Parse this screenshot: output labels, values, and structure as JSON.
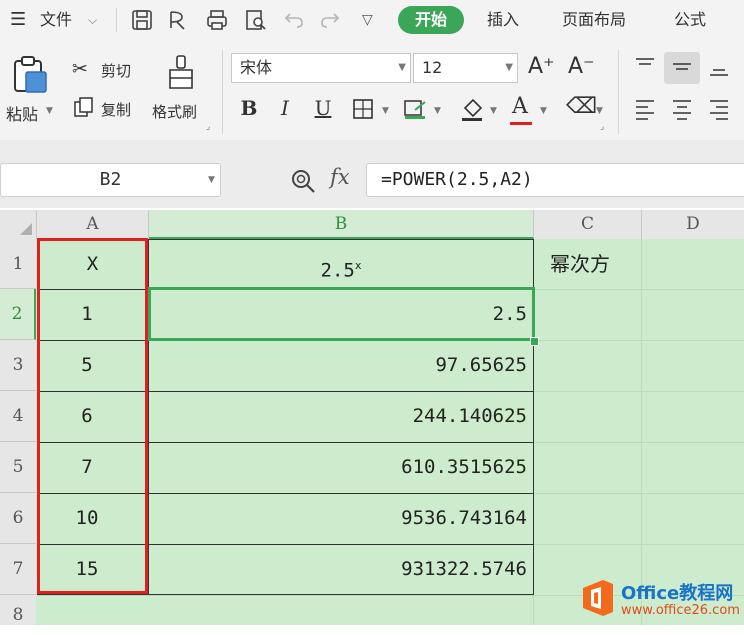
{
  "menubar": {
    "file_label": "文件",
    "tabs": [
      "开始",
      "插入",
      "页面布局",
      "公式"
    ]
  },
  "ribbon": {
    "paste": "粘贴",
    "cut": "剪切",
    "copy": "复制",
    "format_painter": "格式刷",
    "font_name": "宋体",
    "font_size": "12",
    "increase_font": "A⁺",
    "decrease_font": "A⁻",
    "bold": "B",
    "italic": "I",
    "underline": "U"
  },
  "formula_bar": {
    "cell_ref": "B2",
    "fx": "fx",
    "formula": "=POWER(2.5,A2)"
  },
  "sheet": {
    "columns": [
      "A",
      "B",
      "C",
      "D"
    ],
    "rows": [
      "1",
      "2",
      "3",
      "4",
      "5",
      "6",
      "7",
      "8"
    ],
    "a_values": [
      "X",
      "1",
      "5",
      "6",
      "7",
      "10",
      "15"
    ],
    "b_header_base": "2.5",
    "b_header_exp": "x",
    "b_values": [
      "2.5",
      "97.65625",
      "244.140625",
      "610.3515625",
      "9536.743164",
      "931322.5746"
    ],
    "c1": "幂次方"
  },
  "watermark": {
    "brand": "Office教程网",
    "url": "www.office26.com"
  },
  "colors": {
    "accent": "#3ba658",
    "sheet_bg": "#cdeccd",
    "highlight": "#e02020"
  }
}
